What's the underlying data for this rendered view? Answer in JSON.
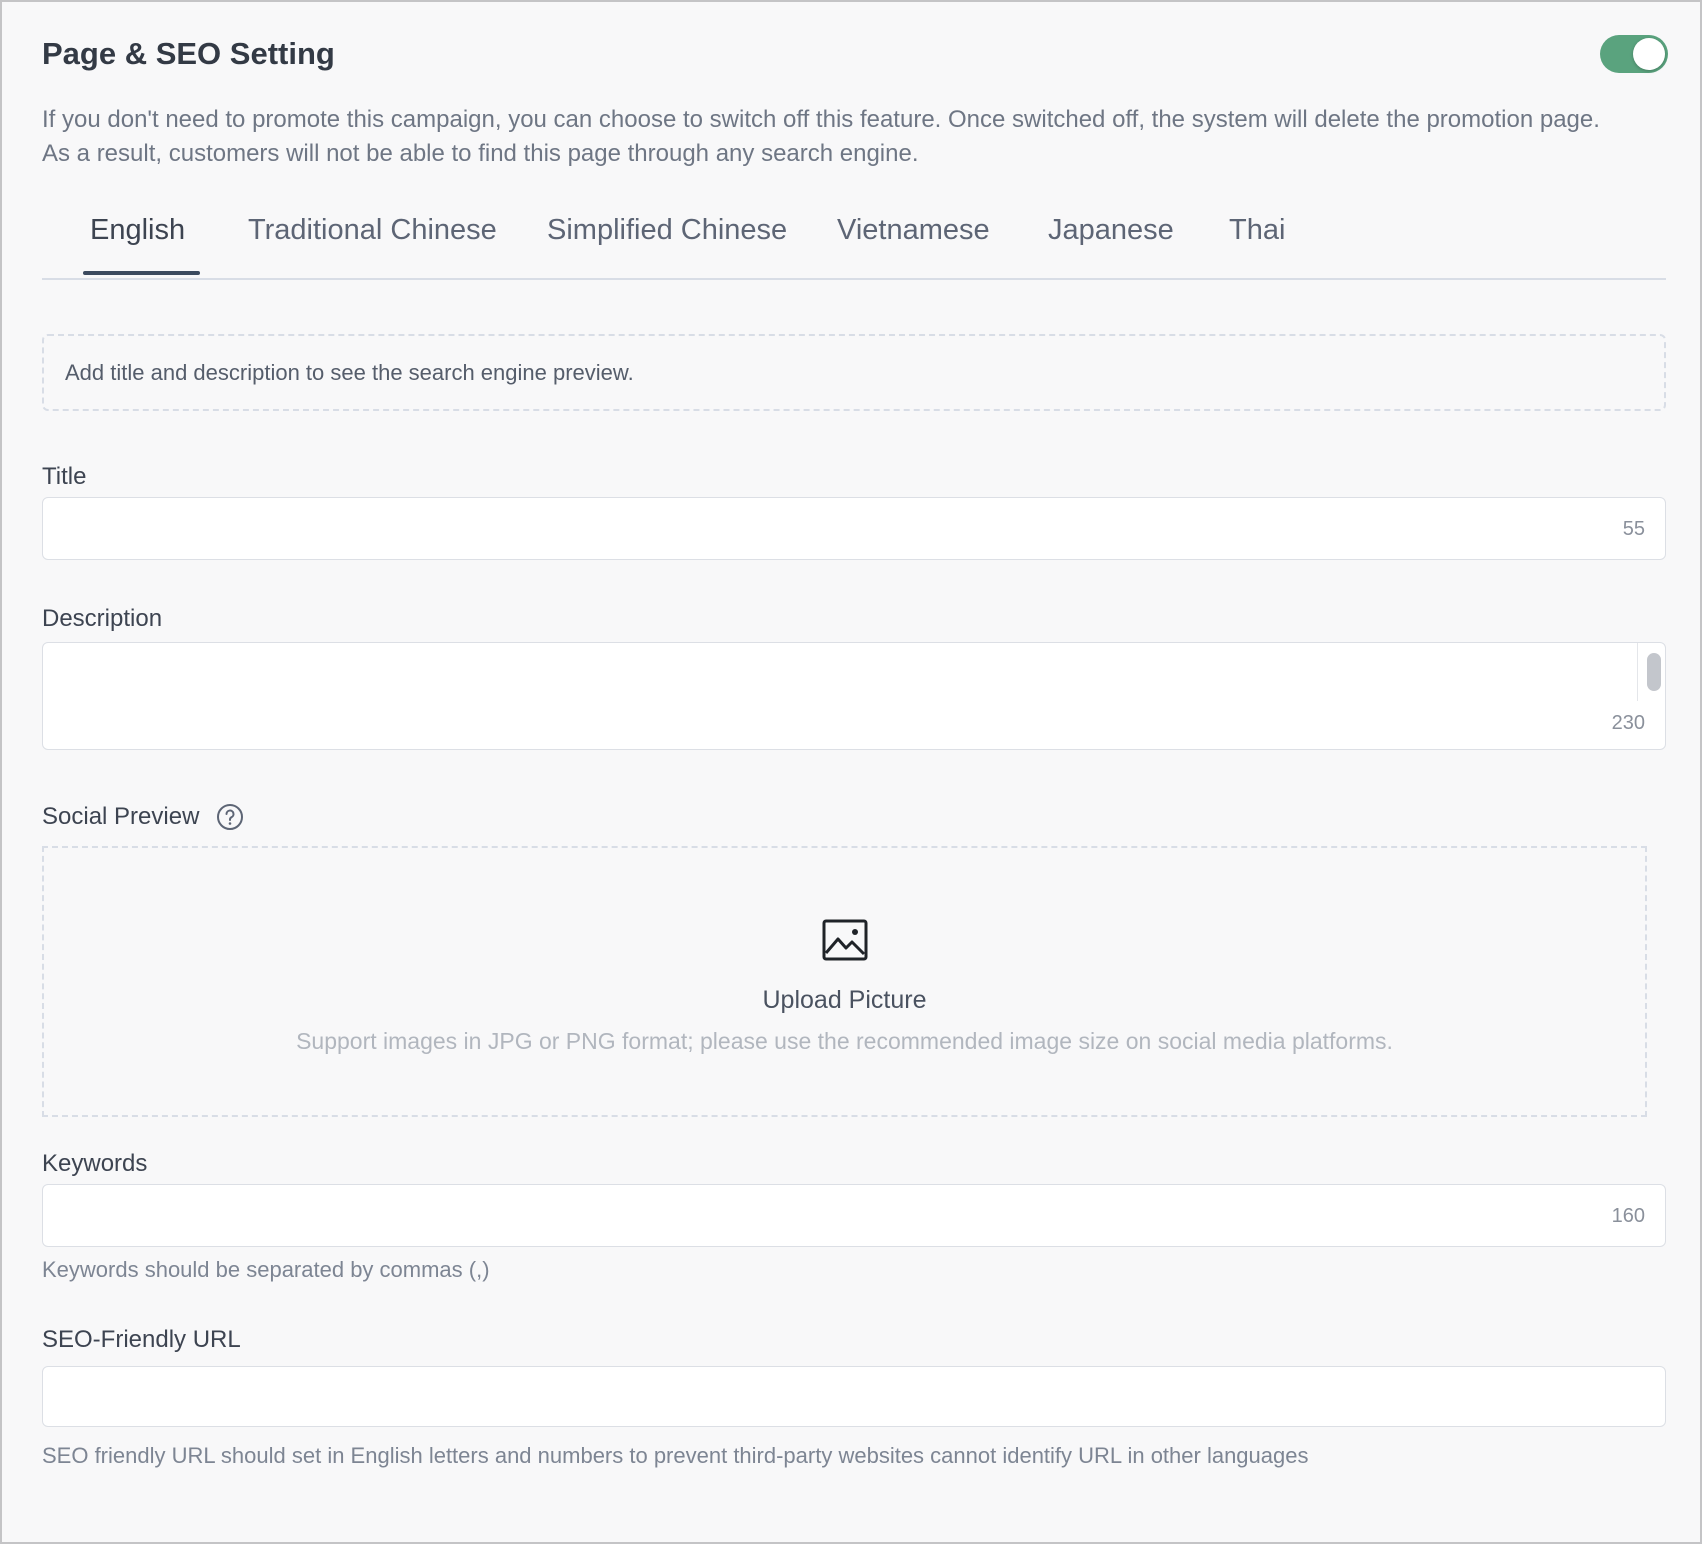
{
  "section": {
    "title": "Page & SEO Setting",
    "enabled": true,
    "description": "If you don't need to promote this campaign, you can choose to switch off this feature. Once switched off, the system will delete the promotion page. As a result, customers will not be able to find this page through any search engine."
  },
  "tabs": [
    {
      "label": "English",
      "active": true
    },
    {
      "label": "Traditional Chinese",
      "active": false
    },
    {
      "label": "Simplified Chinese",
      "active": false
    },
    {
      "label": "Vietnamese",
      "active": false
    },
    {
      "label": "Japanese",
      "active": false
    },
    {
      "label": "Thai",
      "active": false
    }
  ],
  "search_preview": {
    "placeholder": "Add title and description to see the search engine preview."
  },
  "fields": {
    "title": {
      "label": "Title",
      "value": "",
      "limit": "55"
    },
    "description": {
      "label": "Description",
      "value": "",
      "limit": "230"
    },
    "social_preview": {
      "label": "Social Preview",
      "upload_label": "Upload Picture",
      "upload_hint": "Support images in JPG or PNG format; please use the recommended image size on social media platforms."
    },
    "keywords": {
      "label": "Keywords",
      "value": "",
      "limit": "160",
      "hint": "Keywords should be separated by commas (,)"
    },
    "seo_url": {
      "label": "SEO-Friendly URL",
      "value": "",
      "hint": "SEO friendly URL should set in English letters and numbers to prevent third-party websites cannot identify URL in other languages"
    }
  },
  "colors": {
    "toggle_on": "#5aa37e",
    "tab_underline": "#3b4a5e"
  },
  "icons": {
    "help": "question-circle-icon",
    "upload": "image-icon"
  }
}
